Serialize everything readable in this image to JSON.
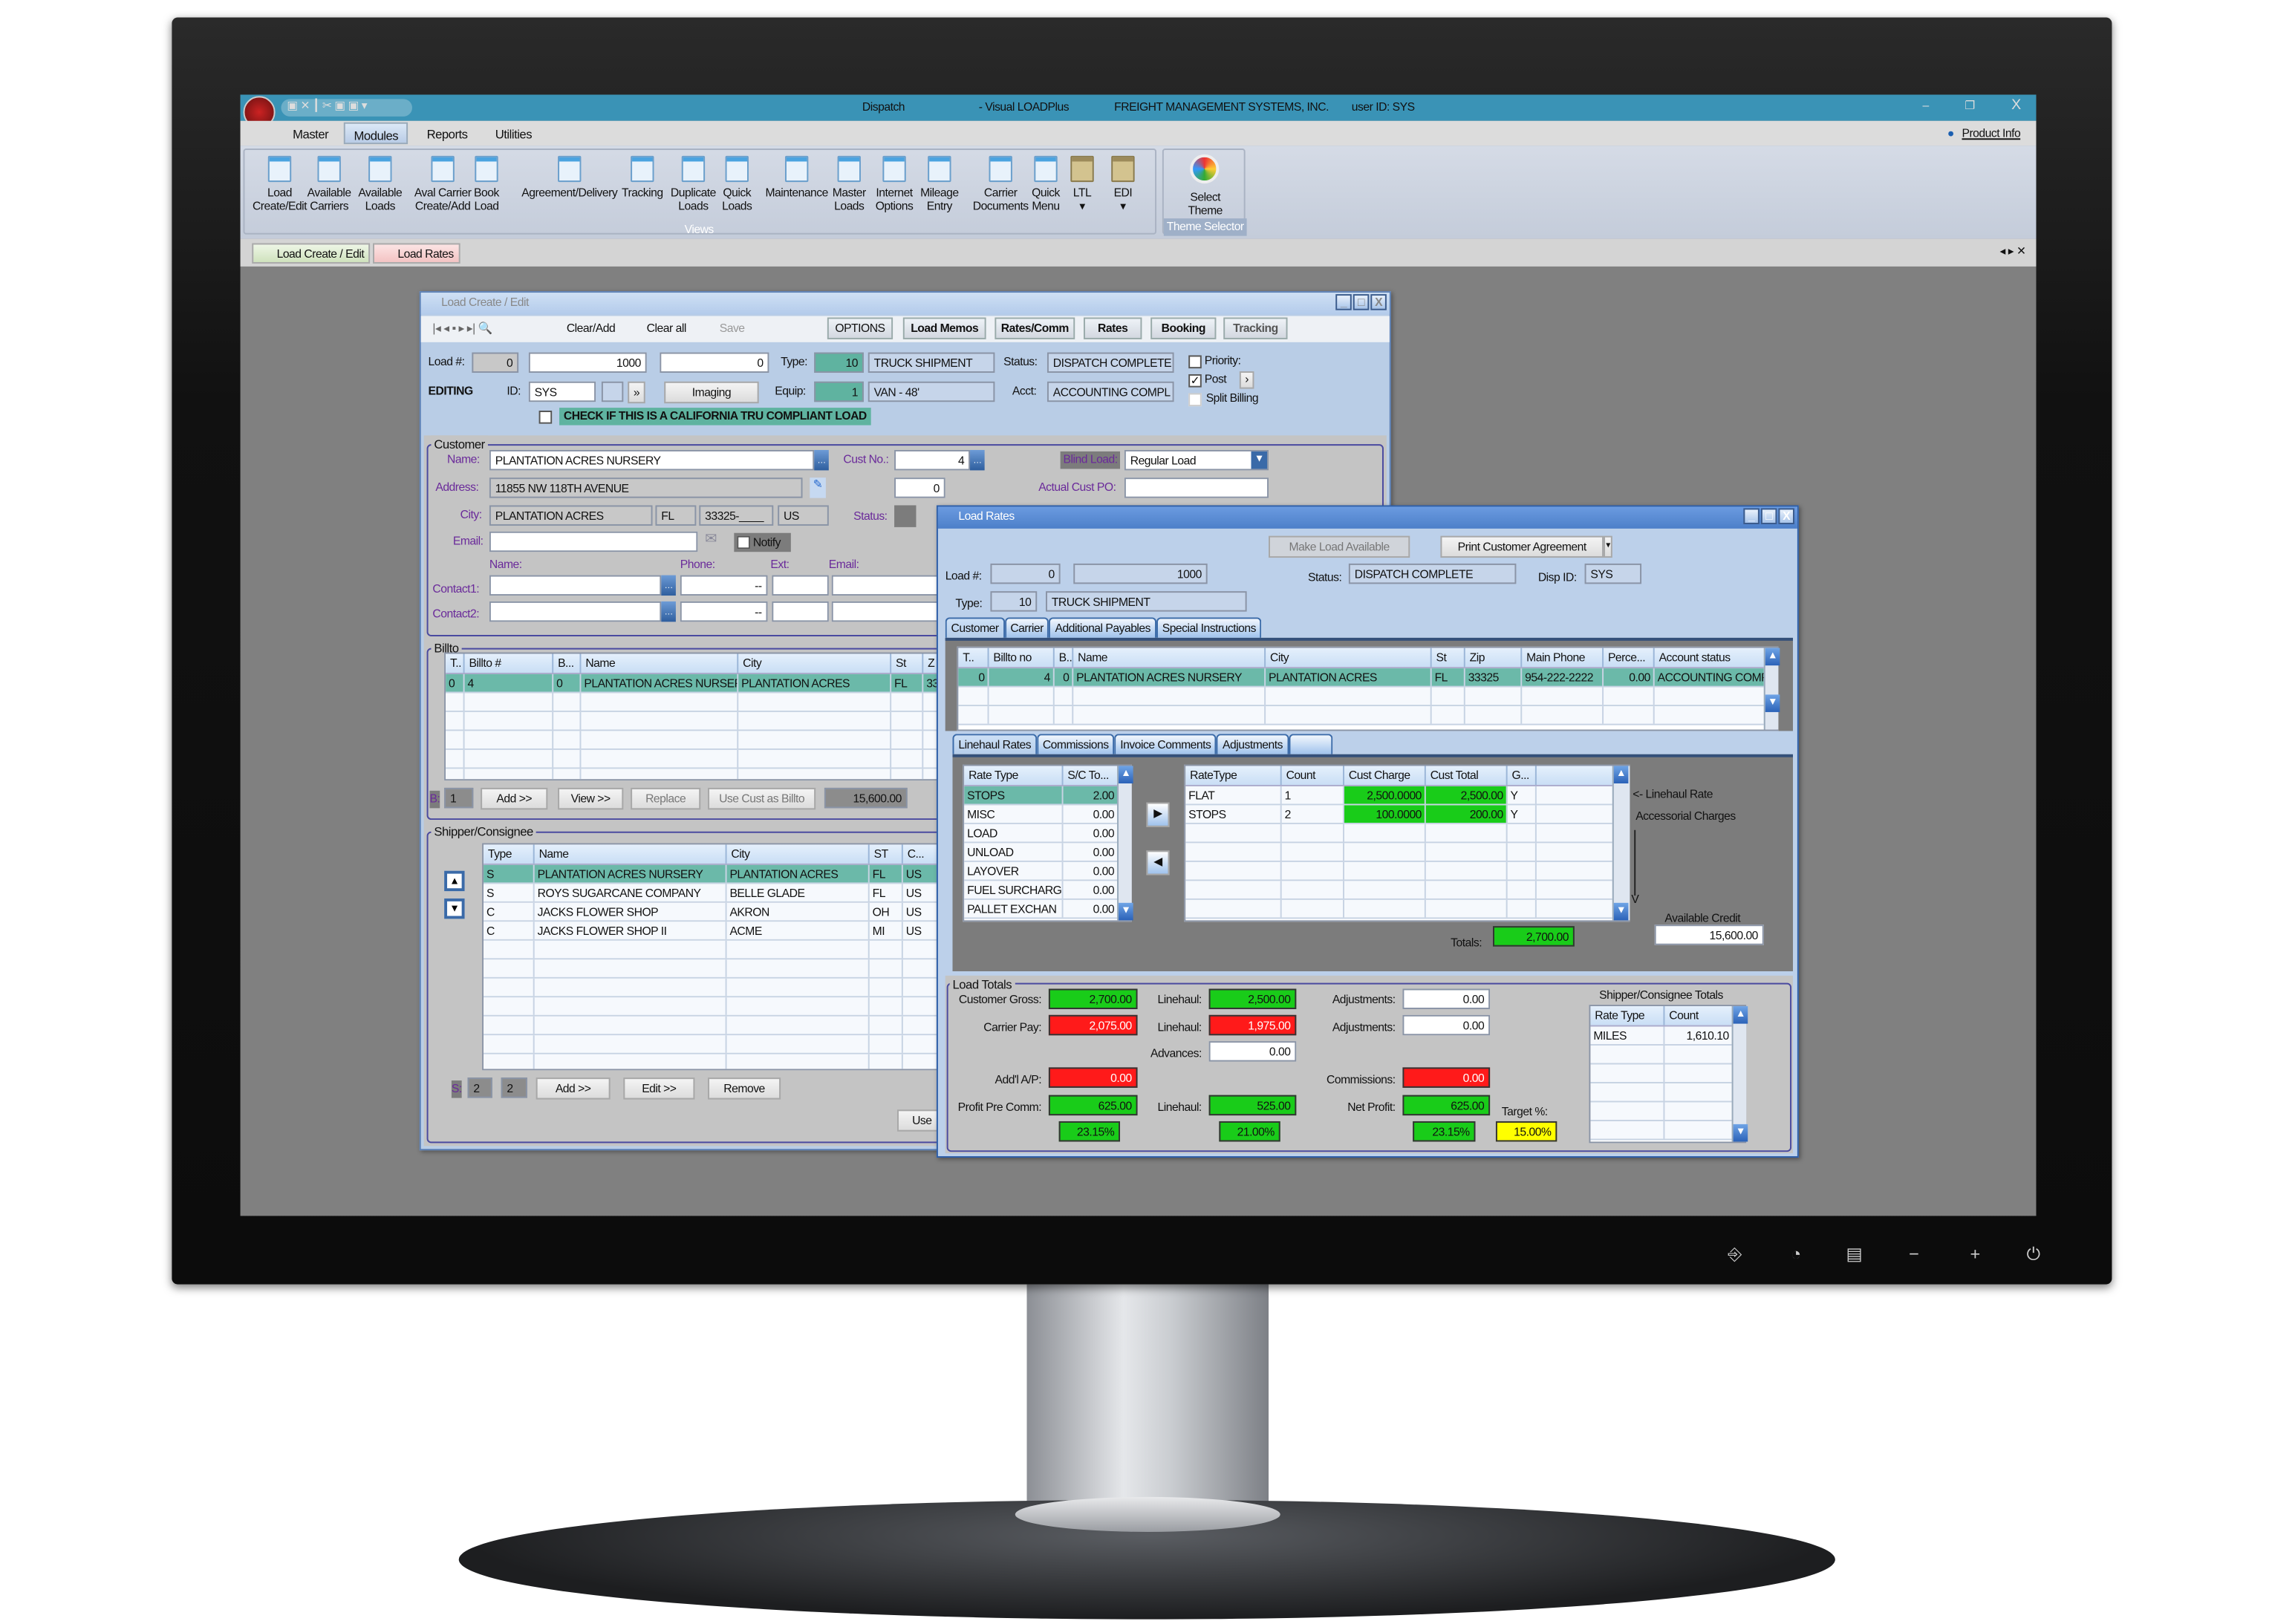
{
  "app": {
    "title": "Dispatch",
    "product": "- Visual LOADPlus",
    "company": "FREIGHT MANAGEMENT SYSTEMS, INC.",
    "user": "user ID:  SYS",
    "product_info": "Product Info"
  },
  "menu": {
    "items": [
      "Master",
      "Modules",
      "Reports",
      "Utilities"
    ],
    "active": "Modules"
  },
  "ribbon": {
    "items": [
      {
        "l1": "Load",
        "l2": "Create/Edit",
        "icon": "window-icon"
      },
      {
        "l1": "Available",
        "l2": "Carriers",
        "icon": "window-icon"
      },
      {
        "l1": "Available",
        "l2": "Loads",
        "icon": "window-icon"
      },
      {
        "l1": "Aval Carrier",
        "l2": "Create/Add",
        "icon": "window-icon"
      },
      {
        "l1": "Book",
        "l2": "Load",
        "icon": "window-icon"
      },
      {
        "l1": "Agreement/Delivery",
        "l2": "",
        "icon": "window-icon"
      },
      {
        "l1": "Tracking",
        "l2": "",
        "icon": "window-icon"
      },
      {
        "l1": "Duplicate",
        "l2": "Loads",
        "icon": "window-icon"
      },
      {
        "l1": "Quick",
        "l2": "Loads",
        "icon": "window-icon"
      },
      {
        "l1": "Maintenance",
        "l2": "",
        "icon": "window-icon"
      },
      {
        "l1": "Master",
        "l2": "Loads",
        "icon": "window-icon"
      },
      {
        "l1": "Internet",
        "l2": "Options",
        "icon": "window-icon"
      },
      {
        "l1": "Mileage",
        "l2": "Entry",
        "icon": "window-icon"
      },
      {
        "l1": "Carrier",
        "l2": "Documents",
        "icon": "window-icon"
      },
      {
        "l1": "Quick",
        "l2": "Menu",
        "icon": "window-icon"
      },
      {
        "l1": "LTL",
        "l2": "▾",
        "icon": "folder-download-icon"
      },
      {
        "l1": "EDI",
        "l2": "▾",
        "icon": "folder-download-icon"
      }
    ],
    "group_views": "Views",
    "theme": {
      "l1": "Select",
      "l2": "Theme",
      "group": "Theme Selector"
    }
  },
  "doc_tabs": [
    "Load Create / Edit",
    "Load Rates"
  ],
  "load_create": {
    "title": "Load Create / Edit",
    "toolbar": {
      "clear_add": "Clear/Add",
      "clear_all": "Clear all",
      "save": "Save",
      "buttons": [
        "OPTIONS",
        "Load Memos",
        "Rates/Comm",
        "Rates",
        "Booking",
        "Tracking"
      ]
    },
    "load_label": "Load #:",
    "load_prefix": "0",
    "load_no": "1000",
    "load_suffix": "0",
    "type_label": "Type:",
    "type_code": "10",
    "type_name": "TRUCK SHIPMENT",
    "status_label": "Status:",
    "status": "DISPATCH COMPLETE",
    "priority": "Priority:",
    "post": "Post",
    "split_billing": "Split Billing",
    "mode": "EDITING",
    "id_label": "ID:",
    "id": "SYS",
    "imaging": "Imaging",
    "equip_label": "Equip:",
    "equip_code": "1",
    "equip_name": "VAN - 48'",
    "acct_label": "Acct:",
    "acct": "ACCOUNTING COMPL",
    "tru_label": "CHECK IF THIS IS A CALIFORNIA TRU COMPLIANT LOAD",
    "customer": {
      "group": "Customer",
      "name_label": "Name:",
      "name": "PLANTATION ACRES NURSERY",
      "custno_label": "Cust No.:",
      "custno": "4",
      "blind_label": "Blind Load:",
      "blind": "Regular Load",
      "address_label": "Address:",
      "address": "11855 NW 118TH AVENUE",
      "addr_no": "0",
      "po_label": "Actual Cust PO:",
      "po": "",
      "city_label": "City:",
      "city": "PLANTATION ACRES",
      "state": "FL",
      "zip": "33325-____",
      "country": "US",
      "status_label": "Status:",
      "email_label": "Email:",
      "email": "",
      "notify": "Notify",
      "h_name": "Name:",
      "h_phone": "Phone:",
      "h_ext": "Ext:",
      "h_email": "Email:",
      "contact1": "Contact1:",
      "contact2": "Contact2:",
      "phone_mask": "--"
    },
    "billto": {
      "group": "Billto",
      "grid": {
        "columns": [
          "T..",
          "Billto #",
          "B...",
          "Name",
          "City",
          "St",
          "Z"
        ],
        "rows": [
          [
            "0",
            "4",
            "0",
            "PLANTATION ACRES NURSERY",
            "PLANTATION ACRES",
            "FL",
            "33"
          ]
        ]
      },
      "b_label": "B:",
      "count": "1",
      "add": "Add >>",
      "view": "View >>",
      "replace": "Replace",
      "use_cust": "Use Cust as Billto",
      "credit": "15,600.00"
    },
    "shipper": {
      "group": "Shipper/Consignee",
      "grid": {
        "columns": [
          "Type",
          "Name",
          "City",
          "ST",
          "C..."
        ],
        "rows": [
          [
            "S",
            "PLANTATION ACRES NURSERY",
            "PLANTATION ACRES",
            "FL",
            "US"
          ],
          [
            "S",
            "ROYS SUGARCANE COMPANY",
            "BELLE GLADE",
            "FL",
            "US"
          ],
          [
            "C",
            "JACKS FLOWER SHOP",
            "AKRON",
            "OH",
            "US"
          ],
          [
            "C",
            "JACKS FLOWER SHOP II",
            "ACME",
            "MI",
            "US"
          ]
        ]
      },
      "s_label": "S:",
      "count1": "2",
      "count2": "2",
      "add": "Add >>",
      "edit": "Edit >>",
      "remove": "Remove",
      "use": "Use"
    }
  },
  "load_rates": {
    "title": "Load Rates",
    "make_available": "Make Load Available",
    "print_agreement": "Print Customer Agreement",
    "load_label": "Load #:",
    "load_prefix": "0",
    "load_no": "1000",
    "status_label": "Status:",
    "status": "DISPATCH COMPLETE",
    "disp_label": "Disp ID:",
    "disp": "SYS",
    "type_label": "Type:",
    "type_code": "10",
    "type_name": "TRUCK SHIPMENT",
    "tabs": [
      "Customer",
      "Carrier",
      "Additional Payables",
      "Special Instructions"
    ],
    "customer_grid": {
      "columns": [
        "T..",
        "Billto no",
        "B..",
        "Name",
        "City",
        "St",
        "Zip",
        "Main Phone",
        "Perce...",
        "Account status"
      ],
      "rows": [
        [
          "0",
          "4",
          "0",
          "PLANTATION ACRES NURSERY",
          "PLANTATION ACRES",
          "FL",
          "33325",
          "954-222-2222",
          "0.00",
          "ACCOUNTING COMPLETE"
        ]
      ]
    },
    "subtabs": [
      "Linehaul Rates",
      "Commissions",
      "Invoice Comments",
      "Adjustments",
      ""
    ],
    "rate_types": {
      "columns": [
        "Rate Type",
        "S/C To..."
      ],
      "rows": [
        [
          "STOPS",
          "2.00"
        ],
        [
          "MISC",
          "0.00"
        ],
        [
          "LOAD",
          "0.00"
        ],
        [
          "UNLOAD",
          "0.00"
        ],
        [
          "LAYOVER",
          "0.00"
        ],
        [
          "FUEL SURCHARG",
          "0.00"
        ],
        [
          "PALLET EXCHAN",
          "0.00"
        ]
      ]
    },
    "rates": {
      "columns": [
        "RateType",
        "Count",
        "Cust Charge",
        "Cust Total",
        "G...",
        ""
      ],
      "rows": [
        [
          "FLAT",
          "1",
          "2,500.0000",
          "2,500.00",
          "Y",
          ""
        ],
        [
          "STOPS",
          "2",
          "100.0000",
          "200.00",
          "Y",
          ""
        ]
      ]
    },
    "linehaul_hint": "<- Linehaul Rate",
    "accessorial_hint": "Accessorial Charges",
    "arrow_v": "V",
    "available_credit_label": "Available Credit",
    "available_credit": "15,600.00",
    "totals_label": "Totals:",
    "totals": "2,700.00",
    "load_totals": {
      "group": "Load Totals",
      "customer_gross_label": "Customer Gross:",
      "customer_gross": "2,700.00",
      "cust_linehaul_label": "Linehaul:",
      "cust_linehaul": "2,500.00",
      "cust_adj_label": "Adjustments:",
      "cust_adj": "0.00",
      "carrier_pay_label": "Carrier Pay:",
      "carrier_pay": "2,075.00",
      "carr_linehaul_label": "Linehaul:",
      "carr_linehaul": "1,975.00",
      "carr_adj_label": "Adjustments:",
      "carr_adj": "0.00",
      "advances_label": "Advances:",
      "advances": "0.00",
      "addl_ap_label": "Add'l A/P:",
      "addl_ap": "0.00",
      "commissions_label": "Commissions:",
      "commissions": "0.00",
      "profit_pre_label": "Profit Pre Comm:",
      "profit_pre": "625.00",
      "profit_linehaul_label": "Linehaul:",
      "profit_linehaul": "525.00",
      "net_profit_label": "Net Profit:",
      "net_profit": "625.00",
      "profit_pre_pct": "23.15%",
      "linehaul_pct": "21.00%",
      "net_pct": "23.15%",
      "target_label": "Target %:",
      "target": "15.00%"
    },
    "sc_totals": {
      "label": "Shipper/Consignee Totals",
      "grid": {
        "columns": [
          "Rate Type",
          "Count"
        ],
        "rows": [
          [
            "MILES",
            "1,610.10"
          ]
        ]
      }
    }
  },
  "colors": {
    "titlebar": "#3a93b6",
    "positive": "#19cc19",
    "negative": "#ff1a1a",
    "target": "#ffff00",
    "selected_row": "#6bb9a9"
  }
}
